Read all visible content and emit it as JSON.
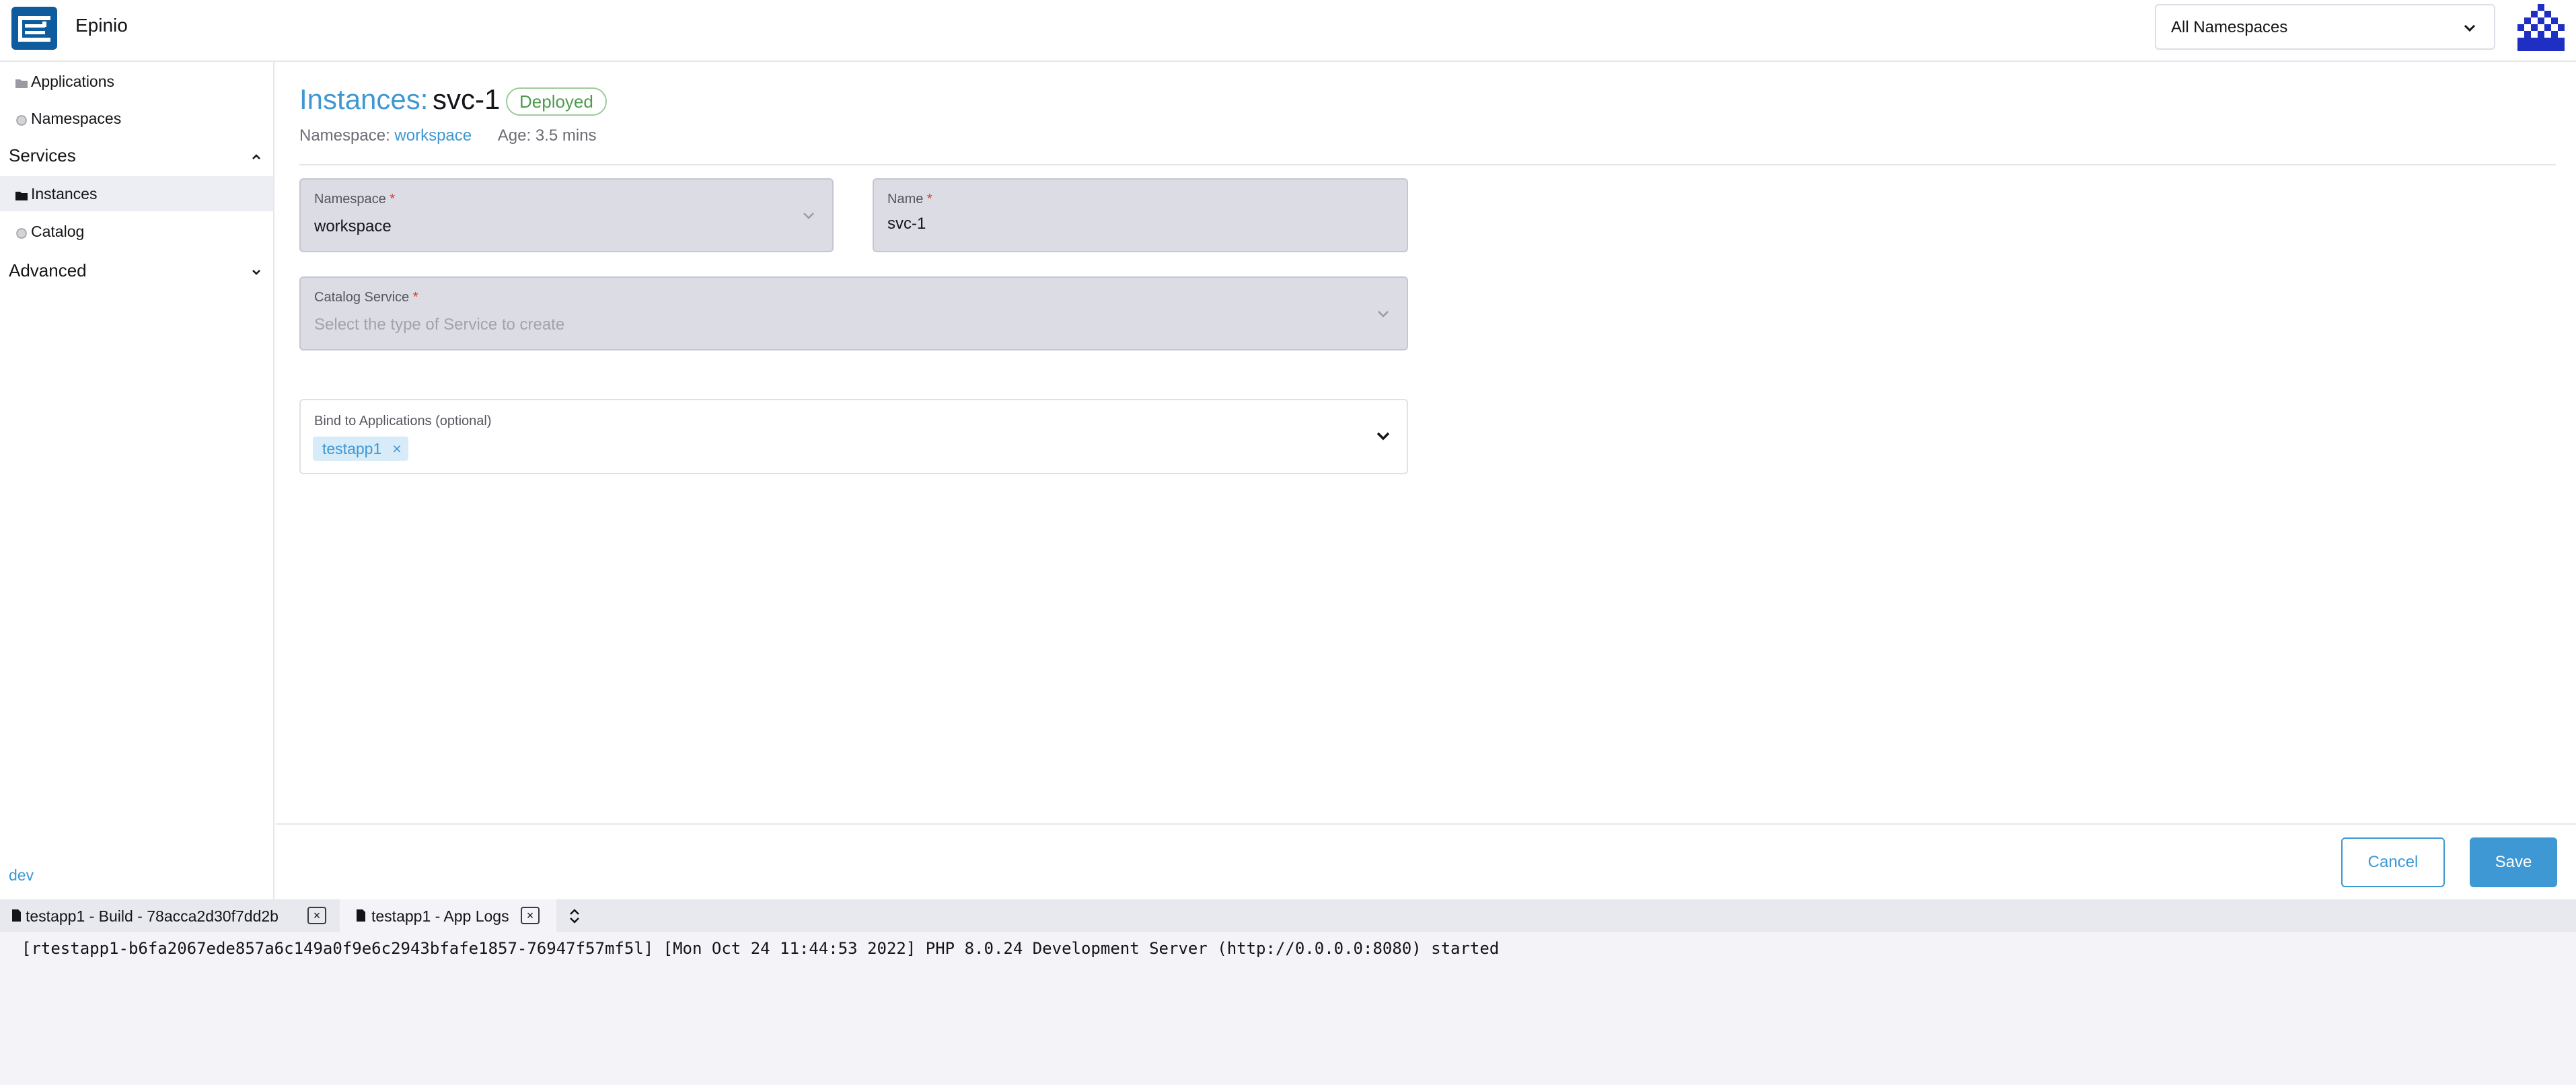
{
  "header": {
    "app_title": "Epinio",
    "namespace_select": "All Namespaces",
    "logo_icon": "epinio-logo-icon",
    "avatar_icon": "user-avatar-icon"
  },
  "sidebar": {
    "items": [
      {
        "label": "Applications",
        "icon": "folder-icon"
      },
      {
        "label": "Namespaces",
        "icon": "circle-icon"
      }
    ],
    "groups": [
      {
        "label": "Services",
        "expanded": true,
        "items": [
          {
            "label": "Instances",
            "icon": "folder-icon",
            "active": true
          },
          {
            "label": "Catalog",
            "icon": "circle-icon"
          }
        ]
      },
      {
        "label": "Advanced",
        "expanded": false
      }
    ],
    "version": "dev"
  },
  "page": {
    "title_prefix": "Instances:",
    "title_name": "svc-1",
    "status": "Deployed",
    "namespace_label": "Namespace:",
    "namespace_value": "workspace",
    "age": "Age: 3.5 mins"
  },
  "form": {
    "namespace": {
      "label": "Namespace",
      "required": "*",
      "value": "workspace"
    },
    "name": {
      "label": "Name",
      "required": "*",
      "value": "svc-1"
    },
    "catalog_service": {
      "label": "Catalog Service",
      "required": "*",
      "placeholder": "Select the type of Service to create"
    },
    "bind_apps": {
      "label": "Bind to Applications (optional)",
      "tags": [
        "testapp1"
      ],
      "tag_remove": "×"
    }
  },
  "actions": {
    "cancel": "Cancel",
    "save": "Save"
  },
  "log_panel": {
    "tabs": [
      {
        "label": "testapp1 - Build - 78acca2d30f7dd2b",
        "close": "×",
        "active": false
      },
      {
        "label": "testapp1 - App Logs",
        "close": "×",
        "active": true
      }
    ],
    "lines": [
      "[rtestapp1-b6fa2067ede857a6c149a0f9e6c2943bfafe1857-76947f57mf5l] [Mon Oct 24 11:44:53 2022] PHP 8.0.24 Development Server (http://0.0.0.0:8080) started"
    ]
  },
  "colors": {
    "accent": "#3d98d3",
    "success": "#4d9b4d",
    "logo": "#0e5b9e",
    "avatar": "#1f2fc4"
  }
}
